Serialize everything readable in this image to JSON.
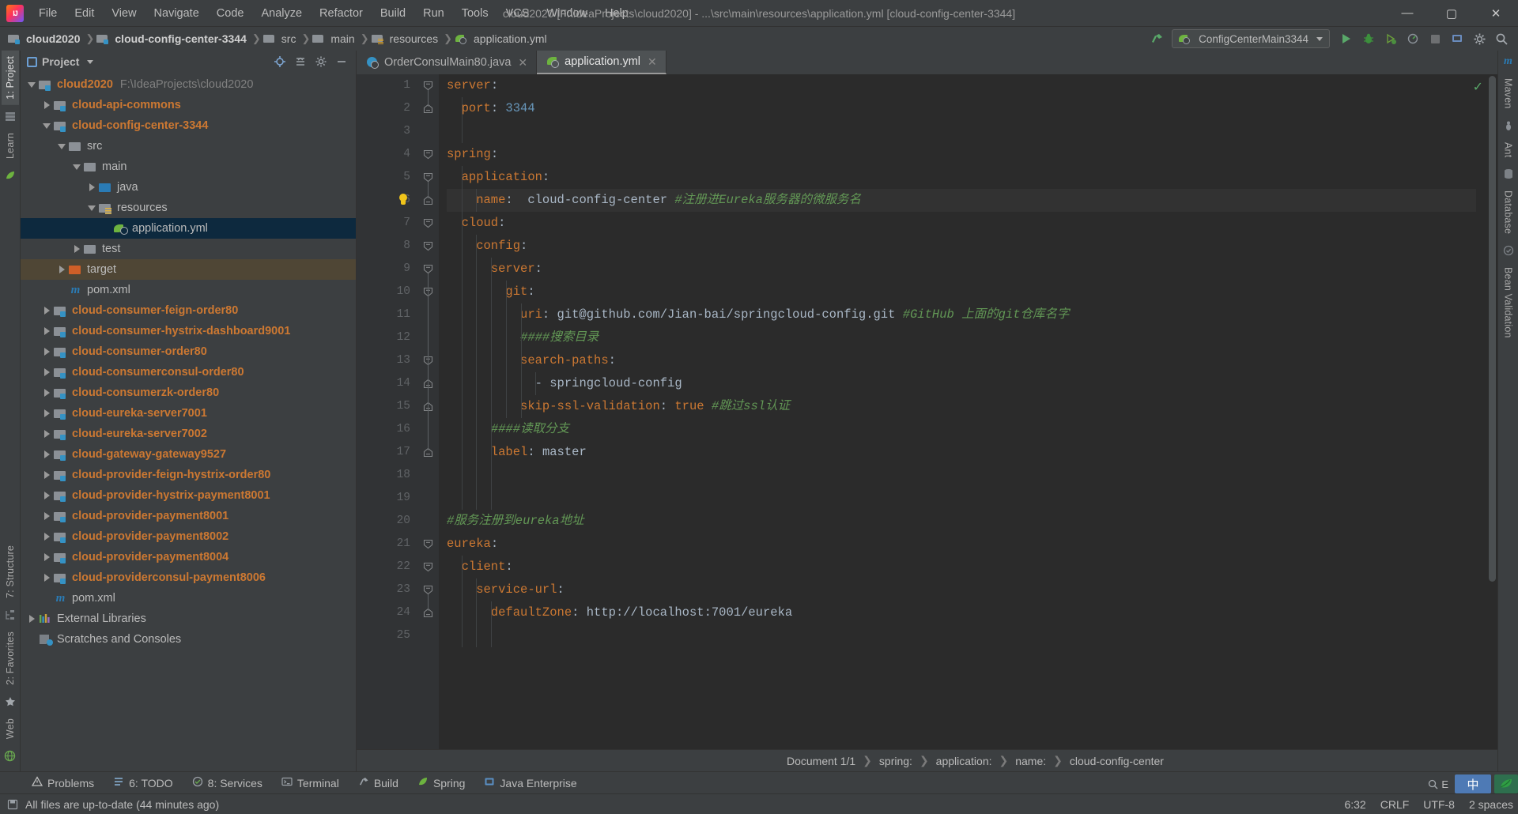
{
  "window": {
    "title": "cloud2020 [F:\\IdeaProjects\\cloud2020] - ...\\src\\main\\resources\\application.yml [cloud-config-center-3344]",
    "minimize": "—",
    "maximize": "▢",
    "close": "✕"
  },
  "menu": [
    {
      "label": "File"
    },
    {
      "label": "Edit"
    },
    {
      "label": "View"
    },
    {
      "label": "Navigate"
    },
    {
      "label": "Code"
    },
    {
      "label": "Analyze"
    },
    {
      "label": "Refactor"
    },
    {
      "label": "Build"
    },
    {
      "label": "Run"
    },
    {
      "label": "Tools"
    },
    {
      "label": "VCS"
    },
    {
      "label": "Window"
    },
    {
      "label": "Help"
    }
  ],
  "navbar": {
    "crumbs": [
      {
        "label": "cloud2020",
        "icon": "module-icon",
        "bold": true
      },
      {
        "label": "cloud-config-center-3344",
        "icon": "module-icon",
        "bold": true
      },
      {
        "label": "src",
        "icon": "folder-icon",
        "bold": false
      },
      {
        "label": "main",
        "icon": "folder-icon",
        "bold": false
      },
      {
        "label": "resources",
        "icon": "resources-folder-icon",
        "bold": false
      },
      {
        "label": "application.yml",
        "icon": "yaml-file-icon",
        "bold": false
      }
    ],
    "separator": "❯",
    "run_configuration": "ConfigCenterMain3344",
    "toolbar_icons": [
      "run-icon",
      "debug-icon",
      "coverage-icon",
      "profile-icon",
      "stop-icon",
      "update-icon",
      "settings-icon",
      "search-icon"
    ]
  },
  "left_strip": {
    "tabs": [
      {
        "label": "1: Project",
        "active": true
      },
      {
        "label": "Learn",
        "active": false
      },
      {
        "label": "7: Structure",
        "active": false
      },
      {
        "label": "2: Favorites",
        "active": false
      },
      {
        "label": "Web",
        "active": false
      }
    ]
  },
  "right_strip": {
    "tabs": [
      {
        "label": "m",
        "active": false
      },
      {
        "label": "Maven",
        "active": false
      },
      {
        "label": "Ant",
        "active": false
      },
      {
        "label": "Database",
        "active": false
      },
      {
        "label": "Bean Validation",
        "active": false
      }
    ]
  },
  "project_panel": {
    "title": "Project",
    "dropdown": "▾",
    "actions": [
      "locate-icon",
      "collapse-all-icon",
      "settings-icon",
      "hide-icon"
    ],
    "tree": [
      {
        "depth": 0,
        "arrow": "open",
        "icon": "module-icon",
        "label": "cloud2020",
        "bold": true,
        "path": "F:\\IdeaProjects\\cloud2020",
        "state": "normal"
      },
      {
        "depth": 1,
        "arrow": "closed",
        "icon": "module-icon",
        "label": "cloud-api-commons",
        "bold": true,
        "path": "",
        "state": "normal"
      },
      {
        "depth": 1,
        "arrow": "open",
        "icon": "module-icon",
        "label": "cloud-config-center-3344",
        "bold": true,
        "path": "",
        "state": "normal"
      },
      {
        "depth": 2,
        "arrow": "open",
        "icon": "folder-icon",
        "label": "src",
        "bold": false,
        "path": "",
        "state": "normal"
      },
      {
        "depth": 3,
        "arrow": "open",
        "icon": "folder-icon",
        "label": "main",
        "bold": false,
        "path": "",
        "state": "normal"
      },
      {
        "depth": 4,
        "arrow": "closed",
        "icon": "source-folder-icon",
        "label": "java",
        "bold": false,
        "path": "",
        "state": "normal"
      },
      {
        "depth": 4,
        "arrow": "open",
        "icon": "resources-folder-icon",
        "label": "resources",
        "bold": false,
        "path": "",
        "state": "normal"
      },
      {
        "depth": 5,
        "arrow": "none",
        "icon": "yaml-file-icon",
        "label": "application.yml",
        "bold": false,
        "path": "",
        "state": "selected"
      },
      {
        "depth": 3,
        "arrow": "closed",
        "icon": "folder-icon",
        "label": "test",
        "bold": false,
        "path": "",
        "state": "normal"
      },
      {
        "depth": 2,
        "arrow": "closed",
        "icon": "target-folder-icon",
        "label": "target",
        "bold": false,
        "path": "",
        "state": "highlight"
      },
      {
        "depth": 2,
        "arrow": "none",
        "icon": "maven-file-icon",
        "label": "pom.xml",
        "bold": false,
        "path": "",
        "state": "normal"
      },
      {
        "depth": 1,
        "arrow": "closed",
        "icon": "module-icon",
        "label": "cloud-consumer-feign-order80",
        "bold": true,
        "path": "",
        "state": "normal"
      },
      {
        "depth": 1,
        "arrow": "closed",
        "icon": "module-icon",
        "label": "cloud-consumer-hystrix-dashboard9001",
        "bold": true,
        "path": "",
        "state": "normal"
      },
      {
        "depth": 1,
        "arrow": "closed",
        "icon": "module-icon",
        "label": "cloud-consumer-order80",
        "bold": true,
        "path": "",
        "state": "normal"
      },
      {
        "depth": 1,
        "arrow": "closed",
        "icon": "module-icon",
        "label": "cloud-consumerconsul-order80",
        "bold": true,
        "path": "",
        "state": "normal"
      },
      {
        "depth": 1,
        "arrow": "closed",
        "icon": "module-icon",
        "label": "cloud-consumerzk-order80",
        "bold": true,
        "path": "",
        "state": "normal"
      },
      {
        "depth": 1,
        "arrow": "closed",
        "icon": "module-icon",
        "label": "cloud-eureka-server7001",
        "bold": true,
        "path": "",
        "state": "normal"
      },
      {
        "depth": 1,
        "arrow": "closed",
        "icon": "module-icon",
        "label": "cloud-eureka-server7002",
        "bold": true,
        "path": "",
        "state": "normal"
      },
      {
        "depth": 1,
        "arrow": "closed",
        "icon": "module-icon",
        "label": "cloud-gateway-gateway9527",
        "bold": true,
        "path": "",
        "state": "normal"
      },
      {
        "depth": 1,
        "arrow": "closed",
        "icon": "module-icon",
        "label": "cloud-provider-feign-hystrix-order80",
        "bold": true,
        "path": "",
        "state": "normal"
      },
      {
        "depth": 1,
        "arrow": "closed",
        "icon": "module-icon",
        "label": "cloud-provider-hystrix-payment8001",
        "bold": true,
        "path": "",
        "state": "normal"
      },
      {
        "depth": 1,
        "arrow": "closed",
        "icon": "module-icon",
        "label": "cloud-provider-payment8001",
        "bold": true,
        "path": "",
        "state": "normal"
      },
      {
        "depth": 1,
        "arrow": "closed",
        "icon": "module-icon",
        "label": "cloud-provider-payment8002",
        "bold": true,
        "path": "",
        "state": "normal"
      },
      {
        "depth": 1,
        "arrow": "closed",
        "icon": "module-icon",
        "label": "cloud-provider-payment8004",
        "bold": true,
        "path": "",
        "state": "normal"
      },
      {
        "depth": 1,
        "arrow": "closed",
        "icon": "module-icon",
        "label": "cloud-providerconsul-payment8006",
        "bold": true,
        "path": "",
        "state": "normal"
      },
      {
        "depth": 1,
        "arrow": "none",
        "icon": "maven-file-icon",
        "label": "pom.xml",
        "bold": false,
        "path": "",
        "state": "normal"
      },
      {
        "depth": 0,
        "arrow": "closed",
        "icon": "external-libraries-icon",
        "label": "External Libraries",
        "bold": false,
        "path": "",
        "state": "normal"
      },
      {
        "depth": 0,
        "arrow": "none",
        "icon": "scratches-icon",
        "label": "Scratches and Consoles",
        "bold": false,
        "path": "",
        "state": "normal"
      }
    ]
  },
  "editor": {
    "tabs": [
      {
        "label": "OrderConsulMain80.java",
        "icon": "java-class-icon",
        "active": false,
        "close": "✕"
      },
      {
        "label": "application.yml",
        "icon": "yaml-file-icon",
        "active": true,
        "close": "✕"
      }
    ],
    "current_line": 6,
    "lines": [
      {
        "n": 1,
        "fold": "open",
        "tokens": [
          {
            "t": "server",
            "c": "k"
          },
          {
            "t": ":",
            "c": "v"
          }
        ],
        "indent": 0
      },
      {
        "n": 2,
        "fold": "end",
        "tokens": [
          {
            "t": "  port",
            "c": "k"
          },
          {
            "t": ": ",
            "c": "v"
          },
          {
            "t": "3344",
            "c": "n"
          }
        ],
        "indent": 1
      },
      {
        "n": 3,
        "fold": "none",
        "tokens": [],
        "indent": 0
      },
      {
        "n": 4,
        "fold": "open",
        "tokens": [
          {
            "t": "spring",
            "c": "k"
          },
          {
            "t": ":",
            "c": "v"
          }
        ],
        "indent": 0
      },
      {
        "n": 5,
        "fold": "open",
        "tokens": [
          {
            "t": "  application",
            "c": "k"
          },
          {
            "t": ":",
            "c": "v"
          }
        ],
        "indent": 1
      },
      {
        "n": 6,
        "fold": "end",
        "tokens": [
          {
            "t": "    name",
            "c": "k"
          },
          {
            "t": ":  ",
            "c": "v"
          },
          {
            "t": "cloud-config-center",
            "c": "v"
          },
          {
            "t": " #注册进Eureka服务器的微服务名",
            "c": "c"
          }
        ],
        "indent": 2
      },
      {
        "n": 7,
        "fold": "open",
        "tokens": [
          {
            "t": "  cloud",
            "c": "k"
          },
          {
            "t": ":",
            "c": "v"
          }
        ],
        "indent": 1
      },
      {
        "n": 8,
        "fold": "open",
        "tokens": [
          {
            "t": "    config",
            "c": "k"
          },
          {
            "t": ":",
            "c": "v"
          }
        ],
        "indent": 2
      },
      {
        "n": 9,
        "fold": "open",
        "tokens": [
          {
            "t": "      server",
            "c": "k"
          },
          {
            "t": ":",
            "c": "v"
          }
        ],
        "indent": 3
      },
      {
        "n": 10,
        "fold": "open",
        "tokens": [
          {
            "t": "        git",
            "c": "k"
          },
          {
            "t": ":",
            "c": "v"
          }
        ],
        "indent": 4
      },
      {
        "n": 11,
        "fold": "none",
        "tokens": [
          {
            "t": "          uri",
            "c": "k"
          },
          {
            "t": ": ",
            "c": "v"
          },
          {
            "t": "git@github.com/Jian-bai/springcloud-config.git",
            "c": "v"
          },
          {
            "t": " #GitHub 上面的git仓库名字",
            "c": "c"
          }
        ],
        "indent": 5
      },
      {
        "n": 12,
        "fold": "none",
        "tokens": [
          {
            "t": "          ####搜索目录",
            "c": "c"
          }
        ],
        "indent": 5
      },
      {
        "n": 13,
        "fold": "open",
        "tokens": [
          {
            "t": "          search-paths",
            "c": "k"
          },
          {
            "t": ":",
            "c": "v"
          }
        ],
        "indent": 5
      },
      {
        "n": 14,
        "fold": "end",
        "tokens": [
          {
            "t": "            - ",
            "c": "dash"
          },
          {
            "t": "springcloud-config",
            "c": "v"
          }
        ],
        "indent": 6
      },
      {
        "n": 15,
        "fold": "end",
        "tokens": [
          {
            "t": "          skip-ssl-validation",
            "c": "k"
          },
          {
            "t": ": ",
            "c": "v"
          },
          {
            "t": "true",
            "c": "b"
          },
          {
            "t": " #跳过ssl认证",
            "c": "c"
          }
        ],
        "indent": 5
      },
      {
        "n": 16,
        "fold": "none",
        "tokens": [
          {
            "t": "      ####读取分支",
            "c": "c"
          }
        ],
        "indent": 3
      },
      {
        "n": 17,
        "fold": "end",
        "tokens": [
          {
            "t": "      label",
            "c": "k"
          },
          {
            "t": ": ",
            "c": "v"
          },
          {
            "t": "master",
            "c": "v"
          }
        ],
        "indent": 3
      },
      {
        "n": 18,
        "fold": "none",
        "tokens": [],
        "indent": 0
      },
      {
        "n": 19,
        "fold": "none",
        "tokens": [],
        "indent": 0
      },
      {
        "n": 20,
        "fold": "none",
        "tokens": [
          {
            "t": "#服务注册到eureka地址",
            "c": "c"
          }
        ],
        "indent": 0
      },
      {
        "n": 21,
        "fold": "open",
        "tokens": [
          {
            "t": "eureka",
            "c": "k"
          },
          {
            "t": ":",
            "c": "v"
          }
        ],
        "indent": 0
      },
      {
        "n": 22,
        "fold": "open",
        "tokens": [
          {
            "t": "  client",
            "c": "k"
          },
          {
            "t": ":",
            "c": "v"
          }
        ],
        "indent": 1
      },
      {
        "n": 23,
        "fold": "open",
        "tokens": [
          {
            "t": "    service-url",
            "c": "k"
          },
          {
            "t": ":",
            "c": "v"
          }
        ],
        "indent": 2
      },
      {
        "n": 24,
        "fold": "end",
        "tokens": [
          {
            "t": "      defaultZone",
            "c": "k"
          },
          {
            "t": ": ",
            "c": "v"
          },
          {
            "t": "http://localhost:7001/eureka",
            "c": "v"
          }
        ],
        "indent": 3
      },
      {
        "n": 25,
        "fold": "none",
        "tokens": [],
        "indent": 0
      }
    ],
    "inspection_status": "✓"
  },
  "breadcrumbs_bottom": {
    "items": [
      "Document 1/1",
      "spring:",
      "application:",
      "name:",
      "cloud-config-center"
    ],
    "separator": "❯"
  },
  "bottom_tools": [
    {
      "label": "Problems",
      "icon": "warning-icon"
    },
    {
      "label": "6: TODO",
      "icon": "todo-icon"
    },
    {
      "label": "8: Services",
      "icon": "services-icon"
    },
    {
      "label": "Terminal",
      "icon": "terminal-icon"
    },
    {
      "label": "Build",
      "icon": "build-icon"
    },
    {
      "label": "Spring",
      "icon": "spring-icon"
    },
    {
      "label": "Java Enterprise",
      "icon": "java-enterprise-icon"
    }
  ],
  "status_bar": {
    "message": "All files are up-to-date (44 minutes ago)",
    "caret": "6:32",
    "line_separator": "CRLF",
    "encoding": "UTF-8",
    "indent": "2 spaces",
    "event_log": "E",
    "ime_language": "中",
    "ime_secondary": "☯"
  }
}
